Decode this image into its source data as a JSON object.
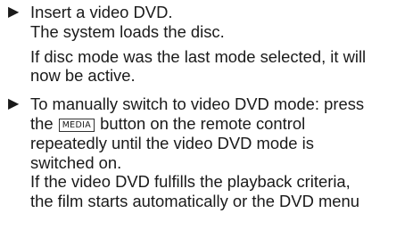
{
  "steps": [
    {
      "lines": [
        "Insert a video DVD.",
        "The system loads the disc."
      ],
      "note_lines": [
        "If disc mode was the last mode selected, it will",
        "now be active."
      ]
    },
    {
      "line1": "To manually switch to video DVD mode: press",
      "line2_before": "the ",
      "key_label": "MEDIA",
      "line2_after": " button on the remote control",
      "line3": "repeatedly until the video DVD mode is",
      "line4": "switched on.",
      "line5": "If the video DVD fulfills the playback criteria,",
      "line6": "the film starts automatically or the DVD menu"
    }
  ]
}
